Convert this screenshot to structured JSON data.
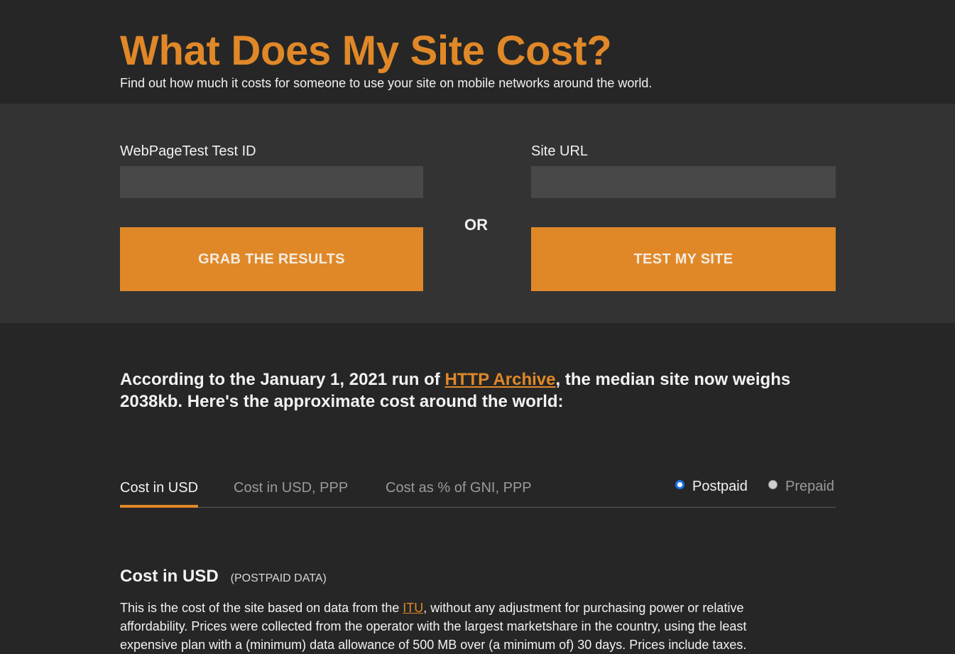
{
  "header": {
    "title": "What Does My Site Cost?",
    "subtitle": "Find out how much it costs for someone to use your site on mobile networks around the world."
  },
  "form": {
    "test_id": {
      "label": "WebPageTest Test ID",
      "value": "",
      "placeholder": ""
    },
    "site_url": {
      "label": "Site URL",
      "value": "",
      "placeholder": ""
    },
    "grab_button": "GRAB THE RESULTS",
    "or_label": "OR",
    "test_button": "TEST MY SITE"
  },
  "intro": {
    "before_link": "According to the January 1, 2021 run of ",
    "link_text": "HTTP Archive",
    "after_link": ", the median site now weighs 2038kb. Here's the approximate cost around the world:"
  },
  "tabs": [
    {
      "label": "Cost in USD",
      "active": true
    },
    {
      "label": "Cost in USD, PPP",
      "active": false
    },
    {
      "label": "Cost as % of GNI, PPP",
      "active": false
    }
  ],
  "plan_type": {
    "options": [
      {
        "label": "Postpaid",
        "checked": true
      },
      {
        "label": "Prepaid",
        "checked": false
      }
    ]
  },
  "section": {
    "title": "Cost in USD",
    "subtitle": "(POSTPAID DATA)",
    "body_before_link": "This is the cost of the site based on data from the ",
    "link_text": "ITU",
    "body_after_link": ", without any adjustment for purchasing power or relative affordability. Prices were collected from the operator with the largest marketshare in the country, using the least expensive plan with a (minimum) data allowance of 500 MB over (a minimum of) 30 days. Prices include taxes."
  },
  "colors": {
    "accent": "#e08828",
    "background": "#262626",
    "panel": "#333333",
    "input": "#484848"
  }
}
